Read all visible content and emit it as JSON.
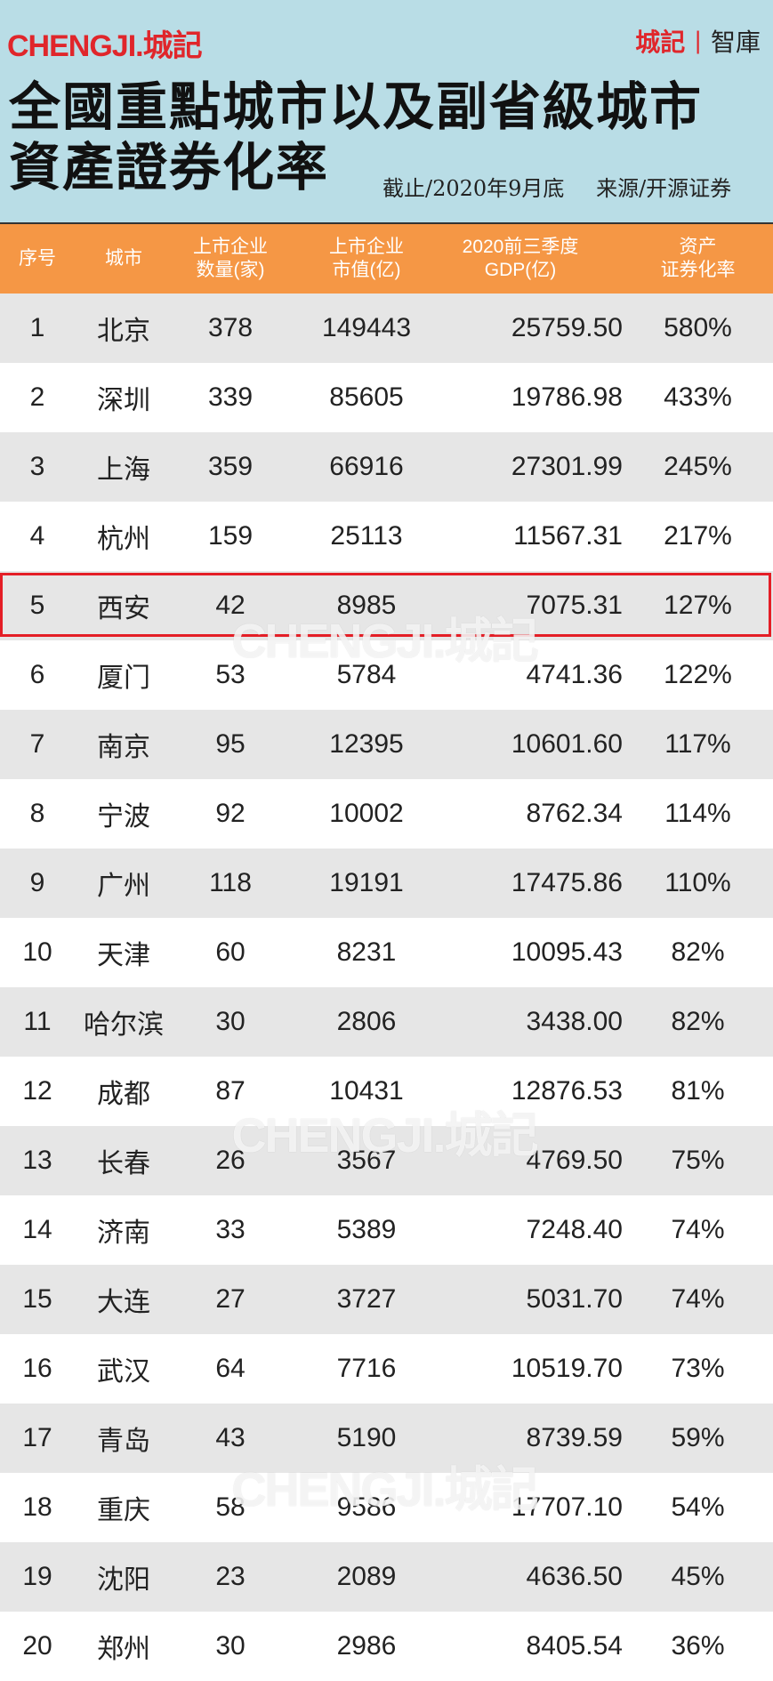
{
  "header": {
    "logo": "CHENGJI.城記",
    "brand_left": "城記",
    "brand_right": "智庫",
    "title_line1": "全國重點城市以及副省級城市",
    "title_line2": "資產證券化率",
    "note_date": "截止/2020年9月底",
    "note_source": "来源/开源证券"
  },
  "colors": {
    "header_bg": "#b9dde6",
    "table_header_bg": "#f59745",
    "row_alt": "#e6e6e6",
    "accent_red": "#e0262b"
  },
  "watermark": "CHENGJI.城記",
  "highlighted_row": 5,
  "chart_data": {
    "type": "table",
    "columns": [
      [
        "序号"
      ],
      [
        "城市"
      ],
      [
        "上市企业",
        "数量(家)"
      ],
      [
        "上市企业",
        "市值(亿)"
      ],
      [
        "2020前三季度",
        "GDP(亿)"
      ],
      [
        "资产",
        "证券化率"
      ]
    ],
    "rows": [
      [
        "1",
        "北京",
        "378",
        "149443",
        "25759.50",
        "580%"
      ],
      [
        "2",
        "深圳",
        "339",
        "85605",
        "19786.98",
        "433%"
      ],
      [
        "3",
        "上海",
        "359",
        "66916",
        "27301.99",
        "245%"
      ],
      [
        "4",
        "杭州",
        "159",
        "25113",
        "11567.31",
        "217%"
      ],
      [
        "5",
        "西安",
        "42",
        "8985",
        "7075.31",
        "127%"
      ],
      [
        "6",
        "厦门",
        "53",
        "5784",
        "4741.36",
        "122%"
      ],
      [
        "7",
        "南京",
        "95",
        "12395",
        "10601.60",
        "117%"
      ],
      [
        "8",
        "宁波",
        "92",
        "10002",
        "8762.34",
        "114%"
      ],
      [
        "9",
        "广州",
        "118",
        "19191",
        "17475.86",
        "110%"
      ],
      [
        "10",
        "天津",
        "60",
        "8231",
        "10095.43",
        "82%"
      ],
      [
        "11",
        "哈尔滨",
        "30",
        "2806",
        "3438.00",
        "82%"
      ],
      [
        "12",
        "成都",
        "87",
        "10431",
        "12876.53",
        "81%"
      ],
      [
        "13",
        "长春",
        "26",
        "3567",
        "4769.50",
        "75%"
      ],
      [
        "14",
        "济南",
        "33",
        "5389",
        "7248.40",
        "74%"
      ],
      [
        "15",
        "大连",
        "27",
        "3727",
        "5031.70",
        "74%"
      ],
      [
        "16",
        "武汉",
        "64",
        "7716",
        "10519.70",
        "73%"
      ],
      [
        "17",
        "青岛",
        "43",
        "5190",
        "8739.59",
        "59%"
      ],
      [
        "18",
        "重庆",
        "58",
        "9586",
        "17707.10",
        "54%"
      ],
      [
        "19",
        "沈阳",
        "23",
        "2089",
        "4636.50",
        "45%"
      ],
      [
        "20",
        "郑州",
        "30",
        "2986",
        "8405.54",
        "36%"
      ]
    ]
  }
}
